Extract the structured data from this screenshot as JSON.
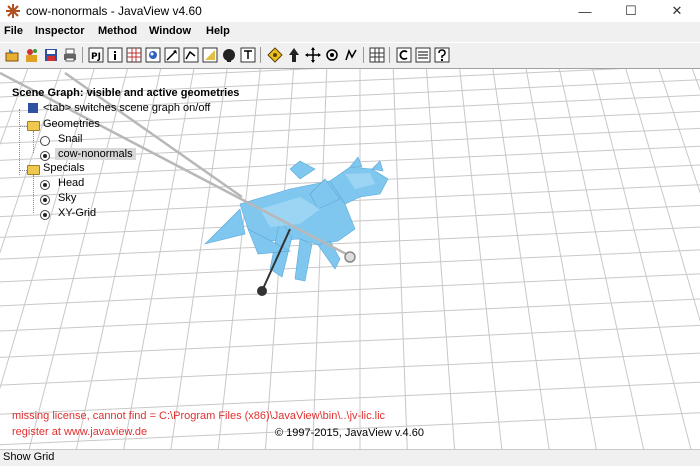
{
  "window": {
    "title": "cow-nonormals - JavaView v4.60",
    "minimize_label": "—",
    "maximize_label": "☐",
    "close_label": "✕"
  },
  "menu": [
    "File",
    "Inspector",
    "Method",
    "Window",
    "Help"
  ],
  "toolbar": {
    "buttons": [
      "open-icon",
      "color-icon",
      "save-icon",
      "print-icon",
      "pj-icon",
      "info-icon",
      "grid-icon",
      "light-icon",
      "vector-icon",
      "paint-icon",
      "camera-icon",
      "text-icon",
      "translate-icon",
      "move-icon",
      "pan-icon",
      "rotate-icon",
      "select-icon",
      "tile-icon",
      "camera-panel-icon",
      "object-panel-icon",
      "help-icon"
    ],
    "labels": {
      "pj": "PJ",
      "info": "i"
    }
  },
  "scene_graph": {
    "title": "Scene Graph: visible and active geometries",
    "hint": "<tab> switches scene graph on/off",
    "groups": [
      {
        "label": "Geometries",
        "items": [
          {
            "label": "Snail",
            "checked": false
          },
          {
            "label": "cow-nonormals",
            "checked": true,
            "selected": true
          }
        ]
      },
      {
        "label": "Specials",
        "items": [
          {
            "label": "Head",
            "checked": true
          },
          {
            "label": "Sky",
            "checked": true
          },
          {
            "label": "XY-Grid",
            "checked": true
          }
        ]
      }
    ]
  },
  "license": {
    "line1": "missing license, cannot find = C:\\Program Files (x86)\\JavaView\\bin\\..\\jv-lic.lic",
    "line2": "register at www.javaview.de"
  },
  "copyright": "© 1997-2015, JavaView v.4.60",
  "status": "Show Grid",
  "colors": {
    "model": "#7fc7ef",
    "license_text": "#e03030"
  }
}
